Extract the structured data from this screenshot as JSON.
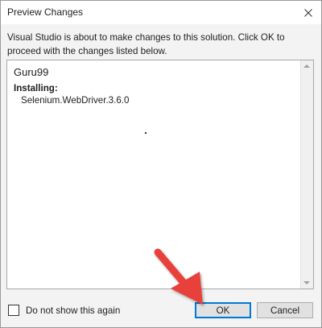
{
  "dialog": {
    "title": "Preview Changes",
    "message": "Visual Studio is about to make changes to this solution. Click OK to proceed with the changes listed below.",
    "changes": {
      "project": "Guru99",
      "action_label": "Installing:",
      "packages": [
        "Selenium.WebDriver.3.6.0"
      ]
    },
    "checkbox": {
      "label": "Do not show this again",
      "checked": false
    },
    "buttons": {
      "ok": "OK",
      "cancel": "Cancel"
    }
  },
  "colors": {
    "annotation_arrow": "#e8413b",
    "accent": "#0078d7"
  },
  "icons": {
    "close": "close-icon",
    "annotation": "red-arrow-icon"
  }
}
